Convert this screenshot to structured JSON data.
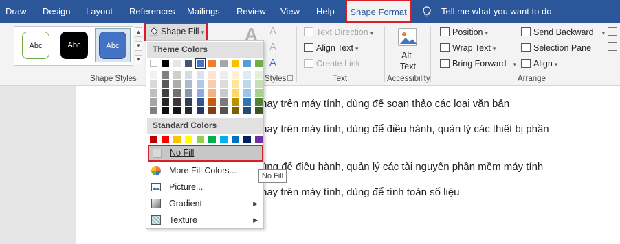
{
  "tabs": {
    "draw": "Draw",
    "design": "Design",
    "layout": "Layout",
    "references": "References",
    "mailings": "Mailings",
    "review": "Review",
    "view": "View",
    "help": "Help",
    "shape_format": "Shape Format",
    "tell_me": "Tell me what you want to do"
  },
  "shape_styles": {
    "samples": [
      "Abc",
      "Abc",
      "Abc"
    ],
    "group_label": "Shape Styles",
    "shape_fill_label": "Shape Fill"
  },
  "wordart": {
    "label_a": "A",
    "group_label": "Styles"
  },
  "text_group": {
    "text_direction": "Text Direction",
    "align_text": "Align Text",
    "create_link": "Create Link",
    "group_label": "Text"
  },
  "accessibility": {
    "alt_text_line1": "Alt",
    "alt_text_line2": "Text",
    "group_label": "Accessibility"
  },
  "arrange": {
    "position": "Position",
    "wrap_text": "Wrap Text",
    "bring_forward": "Bring Forward",
    "send_backward": "Send Backward",
    "selection_pane": "Selection Pane",
    "align": "Align",
    "group_label": "Arrange"
  },
  "document_lines": [
    "hay trên máy tính, dùng để soạn thảo các loại văn bản",
    "hay trên máy tính, dùng để điều hành, quản lý các thiết bị phần",
    "ùng để điều hành, quản lý các tài nguyên phần mềm máy tính",
    "hay trên máy tính, dùng để tính toán số liệu"
  ],
  "fill_menu": {
    "theme_colors_header": "Theme Colors",
    "standard_colors_header": "Standard Colors",
    "no_fill": "No Fill",
    "more_fill_colors": "More Fill Colors...",
    "picture": "Picture...",
    "gradient": "Gradient",
    "texture": "Texture",
    "theme_colors": [
      "#ffffff",
      "#000000",
      "#e7e6e6",
      "#44546a",
      "#4472c4",
      "#ed7d31",
      "#a5a5a5",
      "#ffc000",
      "#5b9bd5",
      "#70ad47"
    ],
    "standard_colors": [
      "#c00000",
      "#ff0000",
      "#ffc000",
      "#ffff00",
      "#92d050",
      "#00b050",
      "#00b0f0",
      "#0070c0",
      "#002060",
      "#7030a0"
    ],
    "theme_shades": [
      [
        "#f2f2f2",
        "#d9d9d9",
        "#bfbfbf",
        "#a6a6a6",
        "#808080"
      ],
      [
        "#808080",
        "#595959",
        "#404040",
        "#262626",
        "#0d0d0d"
      ],
      [
        "#d0cece",
        "#aeabab",
        "#757070",
        "#3a3838",
        "#171616"
      ],
      [
        "#d6dce4",
        "#adb9ca",
        "#8497b0",
        "#333f4f",
        "#222a35"
      ],
      [
        "#dae3f3",
        "#b4c7e7",
        "#8faadc",
        "#2f5597",
        "#1f3864"
      ],
      [
        "#fbe5d6",
        "#f8cbad",
        "#f4b183",
        "#c55a11",
        "#843c0c"
      ],
      [
        "#ededed",
        "#dbdbdb",
        "#c9c9c9",
        "#7b7b7b",
        "#525252"
      ],
      [
        "#fff2cc",
        "#ffe699",
        "#ffd966",
        "#bf9000",
        "#7f6000"
      ],
      [
        "#deebf7",
        "#bdd7ee",
        "#9dc3e6",
        "#2e75b6",
        "#1f4e79"
      ],
      [
        "#e2f0d9",
        "#c5e0b4",
        "#a9d18e",
        "#548235",
        "#385723"
      ]
    ]
  },
  "tooltip": "No Fill",
  "colors": {
    "tab_bar": "#2b579a",
    "highlight": "#d81f26"
  }
}
